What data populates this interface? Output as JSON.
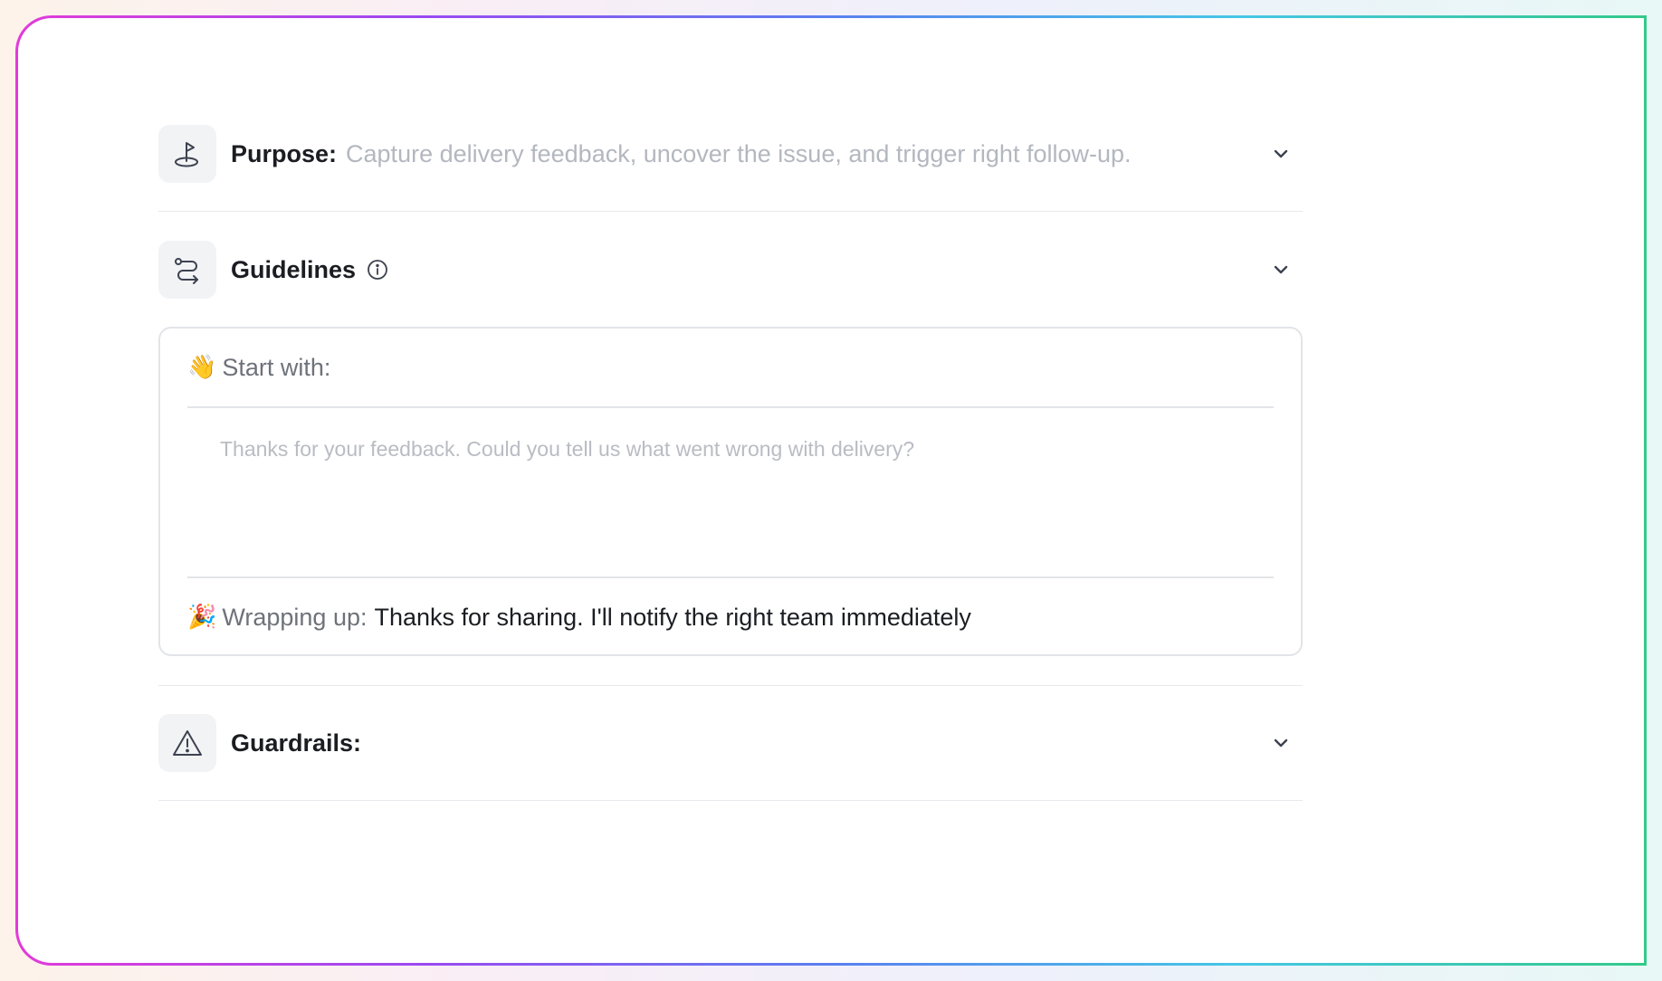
{
  "purpose": {
    "icon": "flag-pin-icon",
    "title": "Purpose:",
    "description": "Capture delivery feedback, uncover the issue, and trigger right follow-up."
  },
  "guidelines": {
    "icon": "route-icon",
    "title": "Guidelines",
    "info_icon": "info-icon",
    "start_with": {
      "emoji": "👋",
      "label": "Start with:",
      "placeholder": "Thanks for your feedback. Could you tell us what went wrong with delivery?"
    },
    "wrapping_up": {
      "emoji": "🎉",
      "label": "Wrapping up:",
      "value": "Thanks for sharing. I'll notify the right team immediately"
    }
  },
  "guardrails": {
    "icon": "warning-triangle-icon",
    "title": "Guardrails:"
  },
  "colors": {
    "frame_gradient": [
      "#e23ad9",
      "#9b4af0",
      "#5a7ff0",
      "#45c7e6",
      "#33c98a"
    ],
    "icon_bg": "#f1f3f5",
    "title_text": "#1b1d22",
    "muted_text": "#b3b7bf"
  }
}
